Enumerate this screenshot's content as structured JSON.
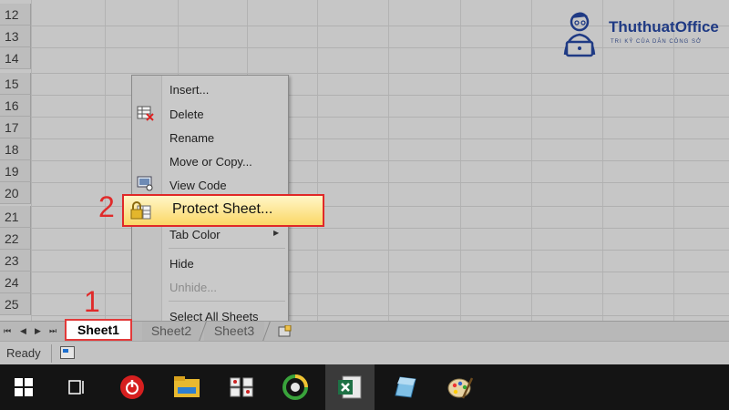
{
  "logo": {
    "name": "ThuthuatOffice",
    "tagline": "TRI KỶ CỦA DÂN CÔNG SỞ",
    "color": "#1f3a84"
  },
  "grid": {
    "rows": [
      "12",
      "13",
      "14",
      "15",
      "16",
      "17",
      "18",
      "19",
      "20",
      "21",
      "22",
      "23",
      "24",
      "25"
    ]
  },
  "context_menu": {
    "items": [
      {
        "label": "Insert...",
        "icon": null,
        "enabled": true
      },
      {
        "label": "Delete",
        "icon": "delete-sheet-icon",
        "enabled": true
      },
      {
        "label": "Rename",
        "icon": null,
        "enabled": true
      },
      {
        "label": "Move or Copy...",
        "icon": null,
        "enabled": true
      },
      {
        "label": "View Code",
        "icon": "view-code-icon",
        "enabled": true
      },
      {
        "label": "Protect Sheet...",
        "icon": "lock-icon",
        "enabled": true,
        "highlighted": true
      },
      {
        "label": "Tab Color",
        "icon": null,
        "enabled": true,
        "submenu": true
      },
      {
        "label": "Hide",
        "icon": null,
        "enabled": true
      },
      {
        "label": "Unhide...",
        "icon": null,
        "enabled": false
      },
      {
        "label": "Select All Sheets",
        "icon": null,
        "enabled": true
      }
    ]
  },
  "sheet_tabs": [
    "Sheet1",
    "Sheet2",
    "Sheet3"
  ],
  "status": {
    "ready": "Ready"
  },
  "annotations": {
    "step1": "1",
    "step2": "2",
    "color": "#e02a2a"
  },
  "taskbar": {
    "items": [
      "windows-start-icon",
      "task-view-icon",
      "power-app-icon",
      "file-explorer-icon",
      "keyboard-app-icon",
      "browser-app-icon",
      "excel-icon",
      "notes-app-icon",
      "paint-app-icon"
    ],
    "active": "excel-icon"
  }
}
